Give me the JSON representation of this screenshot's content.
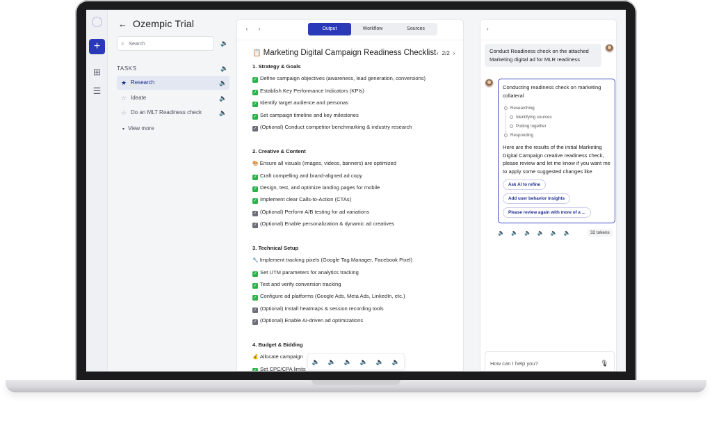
{
  "tasks_panel": {
    "title": "Ozempic Trial",
    "search_placeholder": "Search",
    "section_label": "TASKS",
    "tasks": [
      {
        "label": "Research",
        "active": true
      },
      {
        "label": "Ideate",
        "active": false
      },
      {
        "label": "Do an MLT Readiness check",
        "active": false
      }
    ],
    "view_more": "View more"
  },
  "doc": {
    "tabs": [
      "Output",
      "Workflow",
      "Sources"
    ],
    "active_tab": "Output",
    "title_icon": "📋",
    "title": "Marketing Digital Campaign Readiness Checklist",
    "pager": "2/2",
    "sections": [
      {
        "heading": "1. Strategy & Goals",
        "items": [
          {
            "icon": "check",
            "text": "Define campaign objectives (awareness, lead generation, conversions)"
          },
          {
            "icon": "check",
            "text": "Establish Key Performance Indicators (KPIs)"
          },
          {
            "icon": "check",
            "text": "Identify target audience and personas"
          },
          {
            "icon": "check",
            "text": "Set campaign timeline and key milestones"
          },
          {
            "icon": "grey-check",
            "text": "(Optional) Conduct competitor benchmarking & industry research"
          }
        ]
      },
      {
        "heading": "2. Creative & Content",
        "items": [
          {
            "icon": "palette",
            "text": "Ensure all visuals (images, videos, banners) are optimized"
          },
          {
            "icon": "check",
            "text": "Craft compelling and brand-aligned ad copy"
          },
          {
            "icon": "check",
            "text": "Design, test, and optimize landing pages for mobile"
          },
          {
            "icon": "check",
            "text": "Implement clear Calls-to-Action (CTAs)"
          },
          {
            "icon": "grey-check",
            "text": "(Optional) Perform A/B testing for ad variations"
          },
          {
            "icon": "grey-check",
            "text": "(Optional) Enable personalization & dynamic ad creatives"
          }
        ]
      },
      {
        "heading": "3.  Technical Setup",
        "items": [
          {
            "icon": "wrench",
            "text": "Implement tracking pixels (Google Tag Manager, Facebook Pixel)"
          },
          {
            "icon": "check",
            "text": "Set UTM parameters for analytics tracking"
          },
          {
            "icon": "check",
            "text": "Test and verify conversion tracking"
          },
          {
            "icon": "check",
            "text": "Configure ad platforms (Google Ads, Meta Ads, LinkedIn, etc.)"
          },
          {
            "icon": "grey-check",
            "text": "(Optional) Install heatmaps & session recording tools"
          },
          {
            "icon": "grey-check",
            "text": "(Optional) Enable AI-driven ad optimizations"
          }
        ]
      },
      {
        "heading": "4.  Budget & Bidding",
        "items": [
          {
            "icon": "money-bag",
            "text": "Allocate campaign"
          },
          {
            "icon": "check",
            "text": "Set CPC/CPA limits"
          }
        ]
      }
    ]
  },
  "chat": {
    "user_message": "Conduct Readiness check on the attached Marketing digital ad for MLR readiness",
    "ai_heading": "Conducting readiness check on marketing collateral",
    "steps": [
      {
        "label": "Researching",
        "sub": false
      },
      {
        "label": "Identifying sources",
        "sub": true
      },
      {
        "label": "Putting together",
        "sub": true
      },
      {
        "label": "Responding",
        "sub": false
      }
    ],
    "ai_body": "Here are the results of the initial Marketing Digital Campaign creative readiness check, please review and let me know if you want me to apply some suggested changes like",
    "chips": [
      "Ask AI to refine",
      "Add user behavior insights",
      "Please review again with more of a ..."
    ],
    "tokens": "32 tokens",
    "input_placeholder": "How can I help you?"
  },
  "colors": {
    "accent": "#2a39b8",
    "check_green": "#2bb24c",
    "optional_grey": "#6b6e76"
  }
}
